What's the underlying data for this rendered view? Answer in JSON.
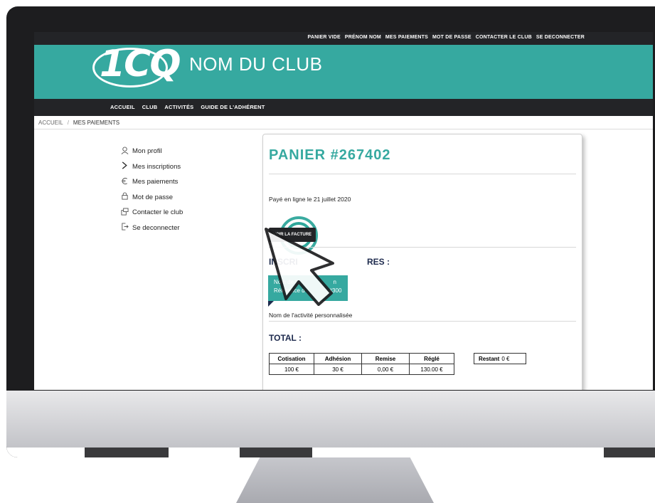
{
  "top_nav": {
    "links": [
      "PANIER VIDE",
      "PRÉNOM NOM",
      "MES PAIEMENTS",
      "MOT DE PASSE",
      "CONTACTER LE CLUB",
      "SE DECONNECTER"
    ]
  },
  "header": {
    "logo_text": "1CQ",
    "club_name": "NOM DU CLUB",
    "brand_color": "#36a9a0"
  },
  "main_nav": {
    "links": [
      "ACCUEIL",
      "CLUB",
      "ACTIVITÉS",
      "GUIDE DE L'ADHÉRENT"
    ]
  },
  "breadcrumb": {
    "home": "ACCUEIL",
    "separator": "/",
    "current": "MES PAIEMENTS"
  },
  "sidebar": {
    "items": [
      {
        "icon": "user-icon",
        "label": "Mon profil"
      },
      {
        "icon": "chevron-right-icon",
        "label": "Mes inscriptions"
      },
      {
        "icon": "euro-icon",
        "label": "Mes paiements"
      },
      {
        "icon": "lock-icon",
        "label": "Mot de passe"
      },
      {
        "icon": "contact-icon",
        "label": "Contacter le club"
      },
      {
        "icon": "logout-icon",
        "label": "Se deconnecter"
      }
    ]
  },
  "cart": {
    "title": "PANIER #267402",
    "paid_text": "Payé en ligne le 21 juillet 2020",
    "invoice_button": "VOIR LA FACTURE",
    "registrations_heading_left": "INSCRI",
    "registrations_heading_right": "RES :",
    "activity_card_line1": "Nom de la",
    "activity_card_line1_suffix": "n",
    "activity_card_line2": "Référence d",
    "activity_card_line2_suffix": "#300",
    "activity_name": "Nom de l'activité personnalisée",
    "total_heading": "TOTAL :",
    "table": {
      "headers": [
        "Cotisation",
        "Adhésion",
        "Remise",
        "Réglé"
      ],
      "values": [
        "100 €",
        "30 €",
        "0,00 €",
        "130.00 €"
      ]
    },
    "remaining_label": "Restant",
    "remaining_value": "0 €"
  }
}
